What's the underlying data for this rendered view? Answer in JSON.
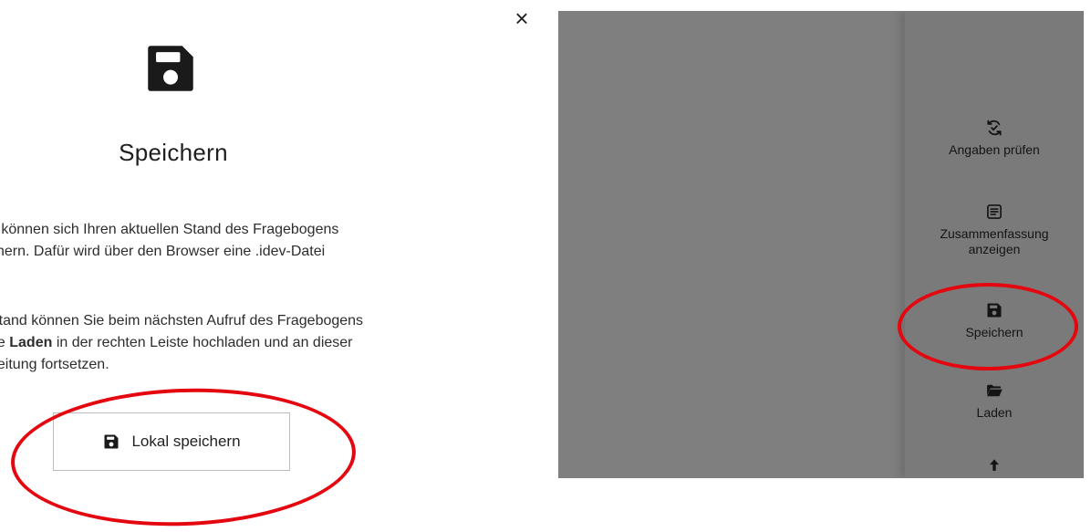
{
  "modal": {
    "close_symbol": "×",
    "icon": "floppy-disk-icon",
    "title": "Speichern",
    "paragraph1": [
      "e können sich Ihren aktuellen Stand des Fragebogens",
      "chern. Dafür wird über den Browser eine .idev-Datei"
    ],
    "paragraph2": {
      "line1": "Stand können Sie beim nächsten Aufruf des Fragebogens",
      "line2_before": "he ",
      "line2_bold": "Laden",
      "line2_after": " in der rechten Leiste hochladen und an dieser",
      "line3": "beitung fortsetzen."
    },
    "button_label": "Lokal speichern",
    "button_icon": "floppy-disk-icon"
  },
  "sidebar": {
    "items": [
      {
        "label": "Angaben prüfen",
        "icon": "refresh-check-icon"
      },
      {
        "label_line1": "Zusammenfassung",
        "label_line2": "anzeigen",
        "icon": "document-list-icon"
      },
      {
        "label": "Speichern",
        "icon": "floppy-disk-icon"
      },
      {
        "label": "Laden",
        "icon": "folder-open-icon"
      },
      {
        "icon": "arrow-up-icon"
      }
    ]
  },
  "colors": {
    "highlight": "#e4070f",
    "overlay": "#7f7f7f",
    "sidebar": "#7a7a7a"
  }
}
